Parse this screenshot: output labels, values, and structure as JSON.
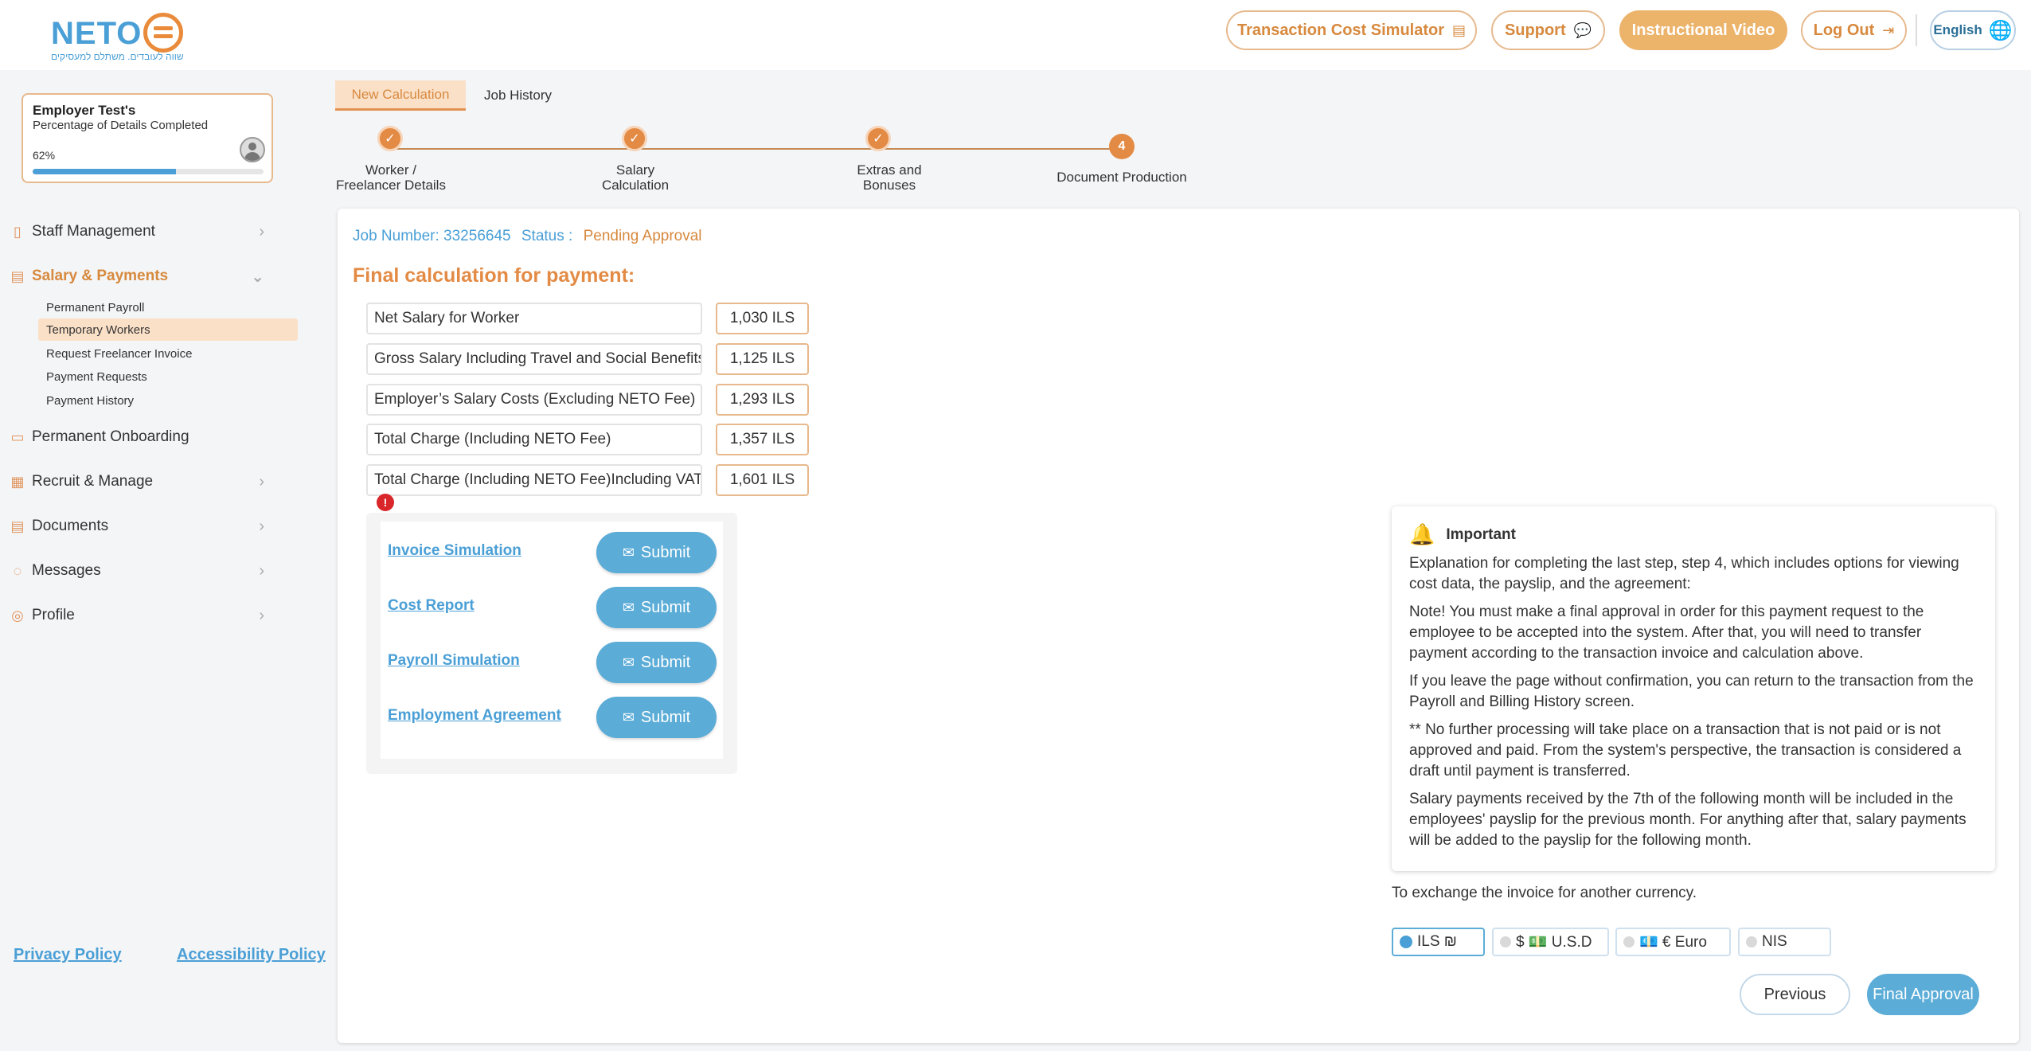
{
  "header": {
    "logo_text": "NETO",
    "logo_tagline": "שווה לעובדים. משתלם למעסיקים",
    "buttons": {
      "simulator": "Transaction Cost Simulator",
      "support": "Support",
      "video": "Instructional Video",
      "logout": "Log Out",
      "language": "English"
    }
  },
  "profile": {
    "name": "Employer Test's",
    "subtitle": "Percentage of Details Completed",
    "percent_label": "62%",
    "percent": 0.62
  },
  "sidebar": {
    "items": [
      {
        "label": "Staff Management",
        "icon": "people-icon"
      },
      {
        "label": "Salary & Payments",
        "icon": "wallet-icon"
      },
      {
        "label": "Permanent Onboarding",
        "icon": "briefcase-icon"
      },
      {
        "label": "Recruit & Manage",
        "icon": "grid-icon"
      },
      {
        "label": "Documents",
        "icon": "document-icon"
      },
      {
        "label": "Messages",
        "icon": "chat-icon"
      },
      {
        "label": "Profile",
        "icon": "user-icon"
      }
    ],
    "sub_items": [
      "Permanent Payroll",
      "Temporary Workers",
      "Request Freelancer Invoice",
      "Payment Requests",
      "Payment History"
    ]
  },
  "footer": {
    "privacy": "Privacy Policy",
    "accessibility": "Accessibility Policy"
  },
  "tabs": [
    "New Calculation",
    "Job History"
  ],
  "steps": [
    {
      "num": "✓",
      "label_line1": "Worker /",
      "label_line2": "Freelancer Details"
    },
    {
      "num": "✓",
      "label_line1": "Salary",
      "label_line2": "Calculation"
    },
    {
      "num": "✓",
      "label_line1": "Extras and",
      "label_line2": "Bonuses"
    },
    {
      "num": "4",
      "label_line1": "Document Production",
      "label_line2": ""
    }
  ],
  "job": {
    "number_label": "Job Number: 33256645",
    "status_label": "Status :",
    "status_value": "Pending Approval"
  },
  "final_title": "Final calculation for payment:",
  "calc_rows": [
    {
      "label": "Net Salary for Worker",
      "value": "1,030 ILS"
    },
    {
      "label": "Gross Salary Including Travel and Social Benefits",
      "value": "1,125 ILS"
    },
    {
      "label": "Employer’s Salary Costs (Excluding NETO Fee)",
      "value": "1,293 ILS"
    },
    {
      "label": "Total Charge (Including NETO Fee)",
      "value": "1,357 ILS"
    },
    {
      "label": "Total Charge (Including NETO Fee)Including VAT",
      "value": "1,601 ILS"
    }
  ],
  "alert_symbol": "!",
  "documents": [
    {
      "label": "Invoice Simulation",
      "button": "Submit"
    },
    {
      "label": "Cost Report",
      "button": "Submit"
    },
    {
      "label": "Payroll Simulation",
      "button": "Submit"
    },
    {
      "label": "Employment Agreement",
      "button": "Submit"
    }
  ],
  "important": {
    "title": "Important",
    "paragraphs": [
      "Explanation for completing the last step, step 4, which includes options for viewing cost data, the payslip, and the agreement:",
      "Note! You must make a final approval in order for this payment request to the employee to be accepted into the system. After that, you will need to transfer payment according to the transaction invoice and calculation above.",
      "If you leave the page without confirmation, you can return to the transaction from the Payroll and Billing History screen.",
      "** No further processing will take place on a transaction that is not paid or is not approved and paid. From the system's perspective, the transaction is considered a draft until payment is transferred.",
      "Salary payments received by the 7th of the following month will be included in the employees' payslip for the previous month. For anything after that, salary payments will be added to the payslip for the following month."
    ]
  },
  "exchange_text": "To exchange the invoice for another currency.",
  "currencies": [
    "ILS ₪",
    "$ 💵 U.S.D",
    "💶 € Euro",
    "NIS"
  ],
  "selected_currency": "ILS ₪",
  "actions": {
    "previous": "Previous",
    "approve": "Final Approval"
  },
  "colors": {
    "accent_orange": "#e38b45",
    "accent_blue": "#4a9fd6",
    "button_blue": "#5bacd7"
  }
}
